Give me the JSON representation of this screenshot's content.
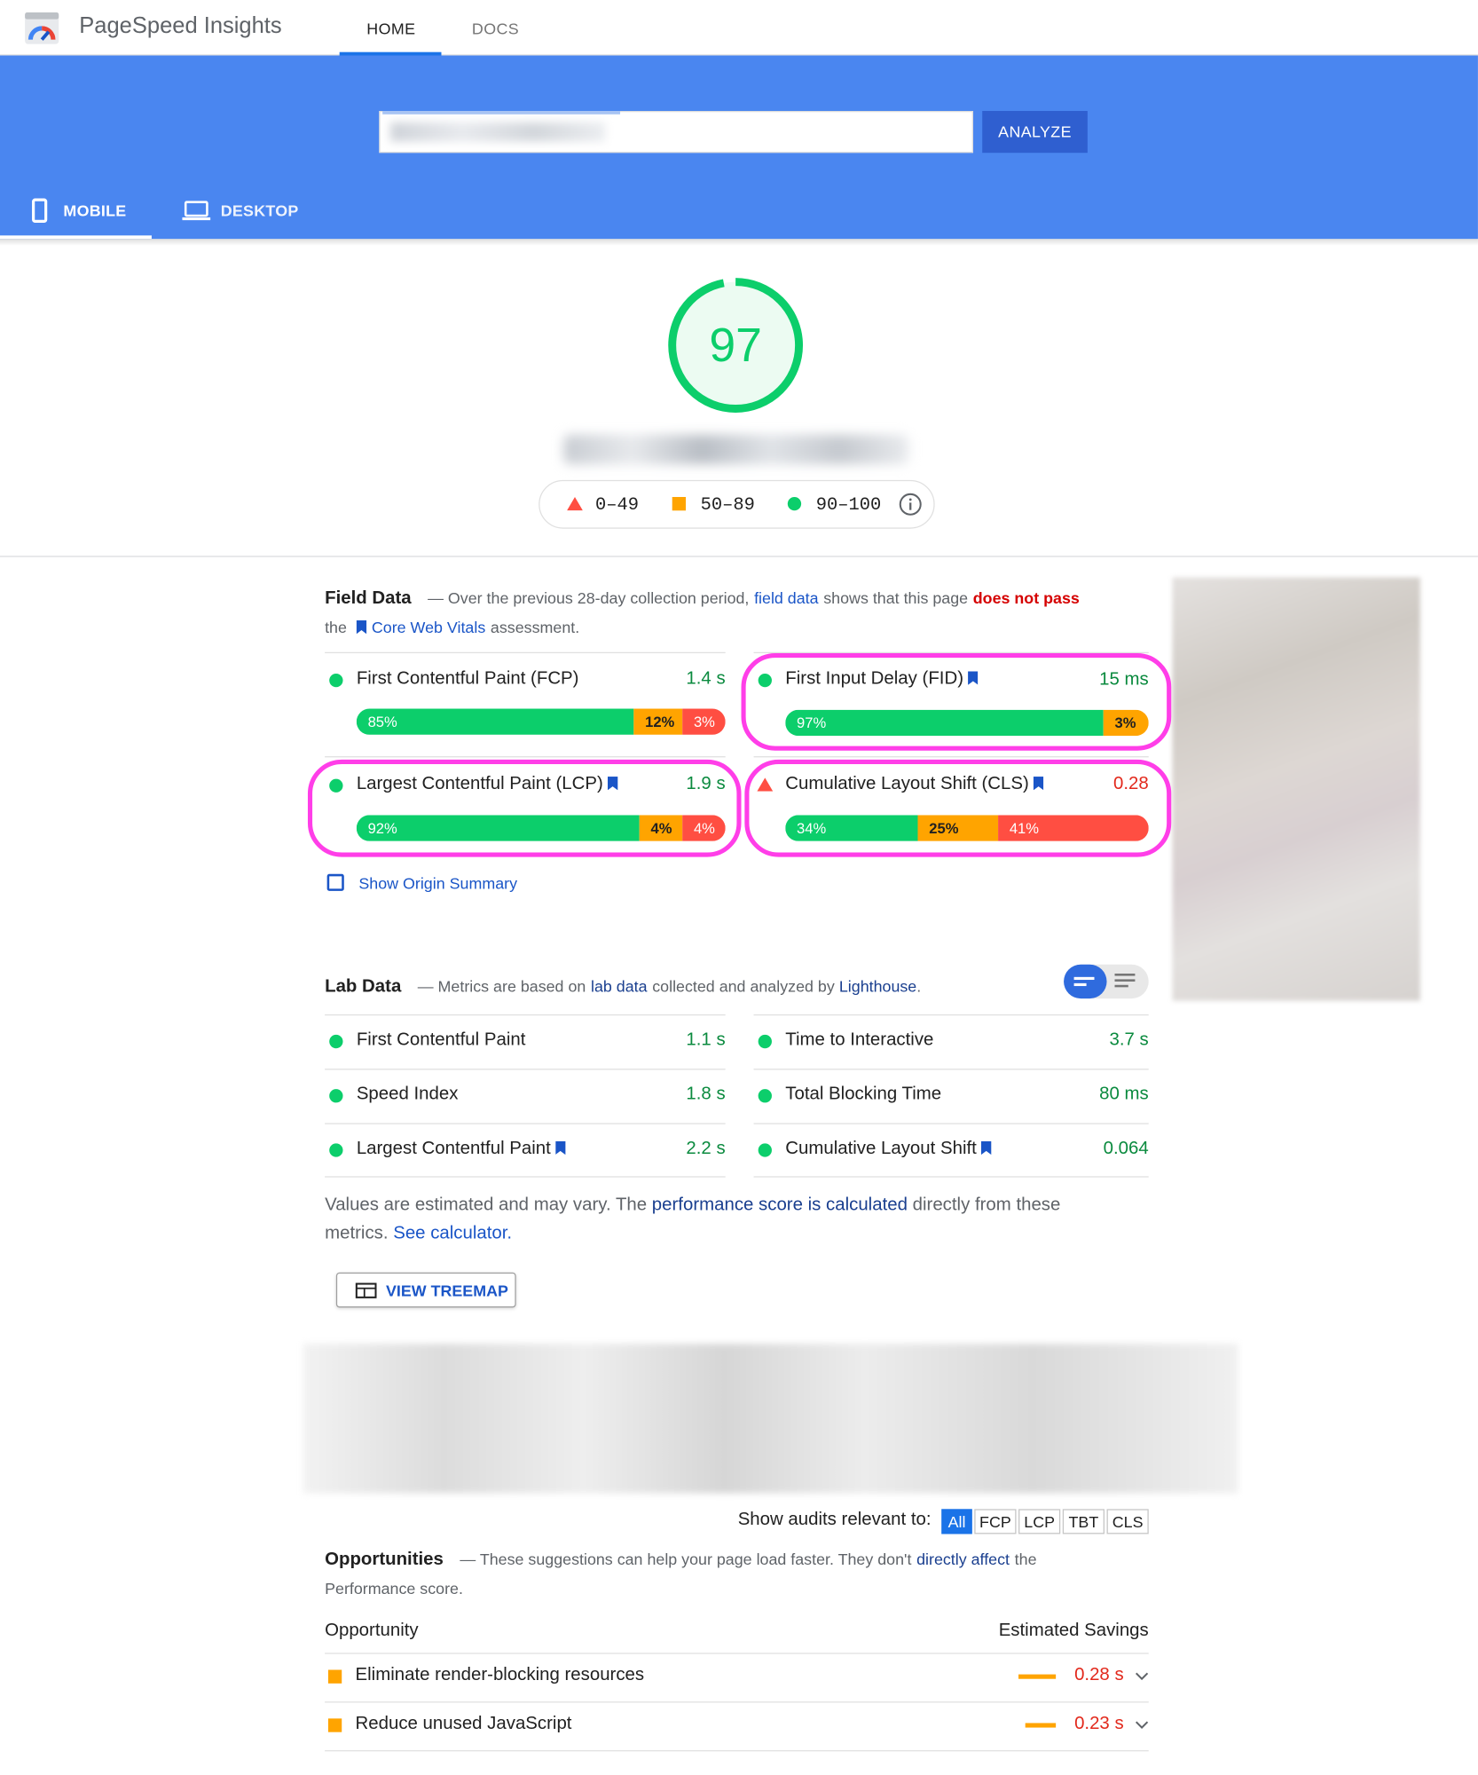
{
  "header": {
    "app_name": "PageSpeed Insights",
    "tabs": [
      "HOME",
      "DOCS"
    ],
    "active_tab": "HOME"
  },
  "search": {
    "analyze_label": "ANALYZE"
  },
  "device_tabs": {
    "mobile": "MOBILE",
    "desktop": "DESKTOP",
    "active": "MOBILE"
  },
  "score": {
    "value": "97",
    "ranges": [
      "0–49",
      "50–89",
      "90–100"
    ]
  },
  "field_data": {
    "title": "Field Data",
    "desc_1": "— Over the previous 28-day collection period,",
    "desc_link": "field data",
    "desc_2": "shows that this page",
    "desc_fail": "does not pass",
    "desc_3": "the",
    "desc_cwv": "Core Web Vitals",
    "desc_4": "assessment.",
    "metrics": [
      {
        "name": "First Contentful Paint (FCP)",
        "value": "1.4 s",
        "dist": [
          "85%",
          "12%",
          "3%"
        ]
      },
      {
        "name": "First Input Delay (FID)",
        "value": "15 ms",
        "dist": [
          "97%",
          "",
          "3%"
        ]
      },
      {
        "name": "Largest Contentful Paint (LCP)",
        "value": "1.9 s",
        "dist": [
          "92%",
          "4%",
          "4%"
        ]
      },
      {
        "name": "Cumulative Layout Shift (CLS)",
        "value": "0.28",
        "dist": [
          "34%",
          "25%",
          "41%"
        ]
      }
    ],
    "origin_summary": "Show Origin Summary"
  },
  "lab_data": {
    "title": "Lab Data",
    "desc_1": "— Metrics are based on",
    "desc_link": "lab data",
    "desc_2": "collected and analyzed by",
    "desc_lighthouse": "Lighthouse",
    "desc_end": ".",
    "metrics": [
      {
        "name": "First Contentful Paint",
        "value": "1.1 s"
      },
      {
        "name": "Time to Interactive",
        "value": "3.7 s"
      },
      {
        "name": "Speed Index",
        "value": "1.8 s"
      },
      {
        "name": "Total Blocking Time",
        "value": "80 ms"
      },
      {
        "name": "Largest Contentful Paint",
        "value": "2.2 s"
      },
      {
        "name": "Cumulative Layout Shift",
        "value": "0.064"
      }
    ],
    "note_1": "Values are estimated and may vary. The",
    "note_link": "performance score is calculated",
    "note_2": "directly from these",
    "note_3": "metrics.",
    "note_calc": "See calculator.",
    "treemap_label": "VIEW TREEMAP"
  },
  "audits": {
    "filter_label": "Show audits relevant to:",
    "filters": [
      "All",
      "FCP",
      "LCP",
      "TBT",
      "CLS"
    ],
    "active_filter": "All"
  },
  "opportunities": {
    "title": "Opportunities",
    "desc_1": "— These suggestions can help your page load faster. They don't",
    "desc_link": "directly affect",
    "desc_2": "the",
    "desc_3": "Performance score.",
    "col_opportunity": "Opportunity",
    "col_savings": "Estimated Savings",
    "items": [
      {
        "name": "Eliminate render-blocking resources",
        "savings": "0.28 s"
      },
      {
        "name": "Reduce unused JavaScript",
        "savings": "0.23 s"
      }
    ]
  },
  "colors": {
    "accent": "#4a86f0",
    "good": "#0cce6b",
    "average": "#ffa400",
    "poor": "#ff4e42",
    "highlight": "#ff3ee8"
  }
}
